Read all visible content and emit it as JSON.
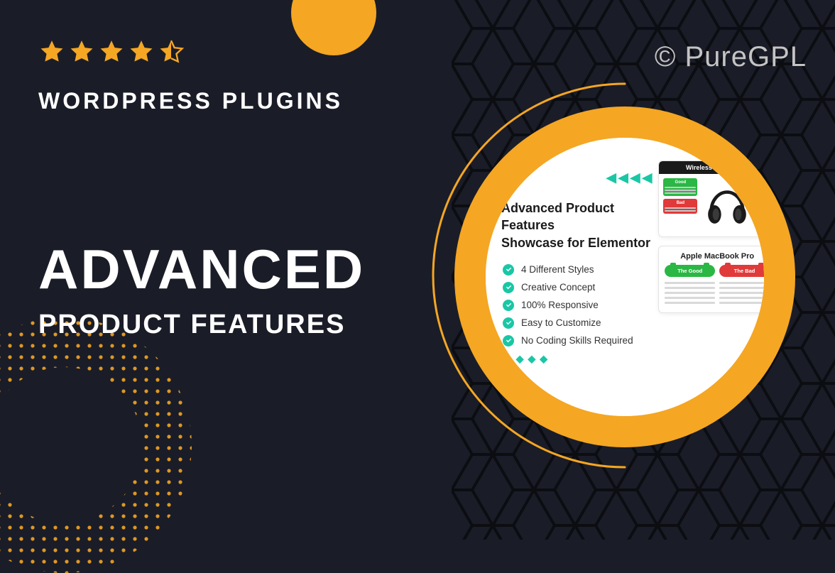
{
  "watermark": "© PureGPL",
  "rating": 4.5,
  "category": "WORDPRESS PLUGINS",
  "title_main": "ADVANCED",
  "title_sub": "PRODUCT FEATURES",
  "accent_color": "#f5a623",
  "showcase": {
    "heading_line1": "Advanced Product Features",
    "heading_line2": "Showcase for Elementor",
    "bullets": [
      "4 Different Styles",
      "Creative Concept",
      "100% Responsive",
      "Easy to Customize",
      "No Coding Skills Required"
    ],
    "card_headphones": {
      "title": "Wireless Headphone",
      "tag_good": "Good",
      "tag_bad": "Bad"
    },
    "card_macbook": {
      "title": "Apple MacBook Pro",
      "col_good": "The Good",
      "col_bad": "The Bad"
    }
  }
}
